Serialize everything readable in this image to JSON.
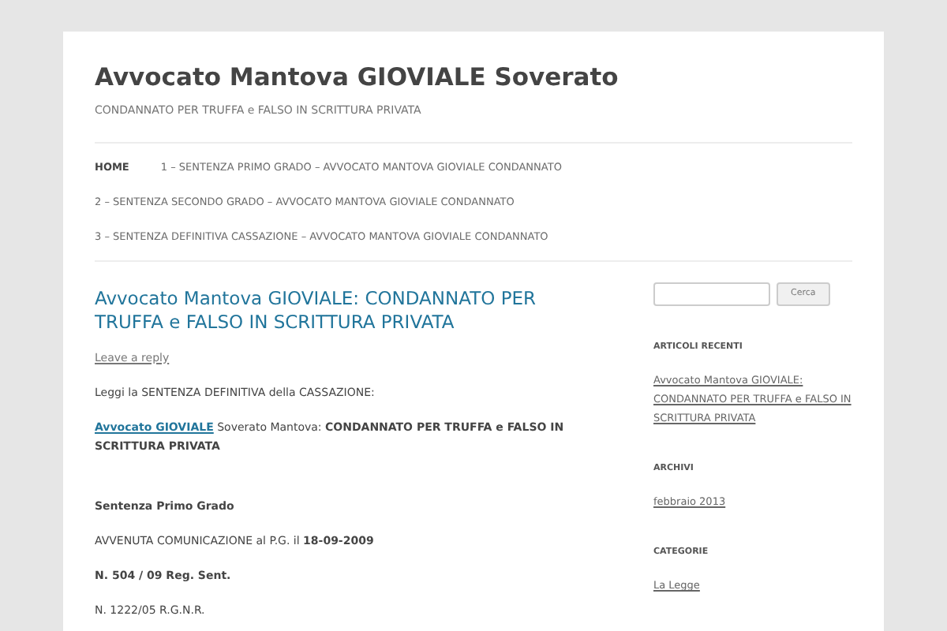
{
  "site": {
    "title": "Avvocato Mantova GIOVIALE Soverato",
    "tagline": "CONDANNATO PER TRUFFA e FALSO IN SCRITTURA PRIVATA"
  },
  "nav": [
    {
      "label": "HOME",
      "selected": true
    },
    {
      "label": "1 – SENTENZA PRIMO GRADO – AVVOCATO MANTOVA GIOVIALE CONDANNATO",
      "selected": false
    },
    {
      "label": "2 – SENTENZA SECONDO GRADO – AVVOCATO MANTOVA GIOVIALE CONDANNATO",
      "selected": false
    },
    {
      "label": "3 – SENTENZA DEFINITIVA CASSAZIONE – AVVOCATO MANTOVA GIOVIALE CONDANNATO",
      "selected": false
    }
  ],
  "post": {
    "title": "Avvocato Mantova GIOVIALE: CONDANNATO PER TRUFFA e FALSO IN SCRITTURA PRIVATA",
    "reply_link": "Leave a reply",
    "paragraphs": [
      {
        "text": "Leggi la SENTENZA DEFINITIVA della CASSAZIONE:"
      },
      {
        "link": "Avvocato GIOVIALE",
        "text": " Soverato Mantova: **CONDANNATO PER TRUFFA e FALSO IN SCRITTURA PRIVATA**",
        "gap_after": true
      },
      {
        "text": "**Sentenza Primo Grado**"
      },
      {
        "text": "AVVENUTA COMUNICAZIONE al P.G. il **18-09-2009**"
      },
      {
        "text": "**N. 504 / 09 Reg. Sent.**"
      },
      {
        "text": "N. 1222/05 R.G.N.R."
      }
    ]
  },
  "sidebar": {
    "search": {
      "button": "Cerca"
    },
    "widgets": [
      {
        "title": "ARTICOLI RECENTI",
        "links": [
          "Avvocato Mantova GIOVIALE: CONDANNATO PER TRUFFA e FALSO IN SCRITTURA PRIVATA"
        ]
      },
      {
        "title": "ARCHIVI",
        "links": [
          "febbraio 2013"
        ]
      },
      {
        "title": "CATEGORIE",
        "links": [
          "La Legge"
        ]
      }
    ]
  }
}
